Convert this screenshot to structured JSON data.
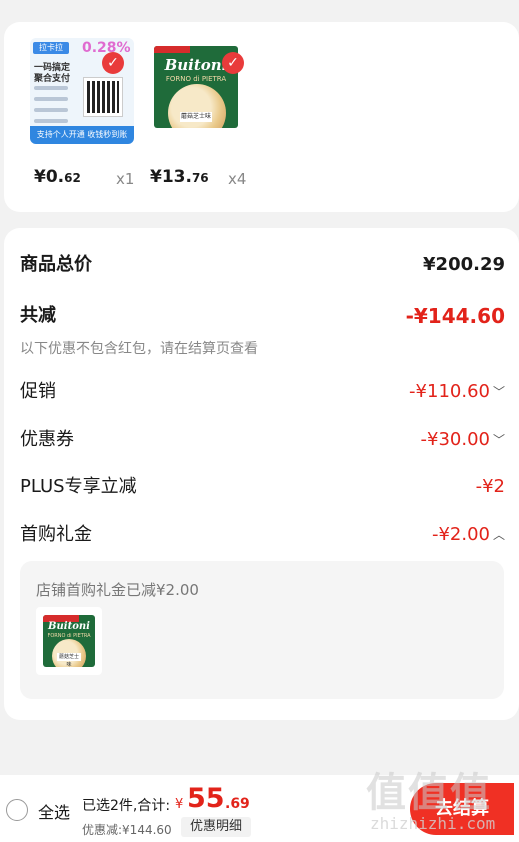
{
  "items": [
    {
      "name": "payment-service",
      "thumb_brand": "拉卡拉",
      "thumb_rate": "0.28%",
      "thumb_line1": "一码搞定",
      "thumb_line2": "聚合支付",
      "thumb_banner": "支持个人开通 收钱秒到账",
      "price_int": "¥0.",
      "price_dec": "62",
      "qty": "x1",
      "selected": true
    },
    {
      "name": "buitoni-pizza",
      "thumb_brand": "Buitoni",
      "thumb_sub": "FORNO di PIETRA",
      "thumb_label": "蘑菇芝士味",
      "price_int": "¥13.",
      "price_dec": "76",
      "qty": "x4",
      "selected": true
    }
  ],
  "summary": {
    "total_label": "商品总价",
    "total_value": "¥200.29",
    "reduce_label": "共减",
    "reduce_value": "-¥144.60",
    "note": "以下优惠不包含红包，请在结算页查看",
    "promo_label": "促销",
    "promo_value": "-¥110.60",
    "coupon_label": "优惠券",
    "coupon_value": "-¥30.00",
    "plus_label": "PLUS专享立减",
    "plus_value": "-¥2",
    "gift_label": "首购礼金",
    "gift_value": "-¥2.00",
    "gift_detail": "店铺首购礼金已减¥2.00",
    "gift_thumb_brand": "Buitoni"
  },
  "bottom_bar": {
    "select_all": "全选",
    "selected_count": "已选2件,合计:",
    "currency": "¥",
    "total_int": "55",
    "total_dec": ".69",
    "discount": "优惠减:¥144.60",
    "detail_button": "优惠明细",
    "checkout_button": "去结算"
  },
  "watermark": {
    "logo": "值值值",
    "url": "zhizhizhi.com"
  },
  "colors": {
    "accent_red": "#e2231a",
    "checkout_red": "#f03024",
    "background": "#f2f2f2"
  },
  "icons": {
    "check": "check-icon",
    "chevron_down": "chevron-down-icon",
    "chevron_up": "chevron-up-icon"
  }
}
